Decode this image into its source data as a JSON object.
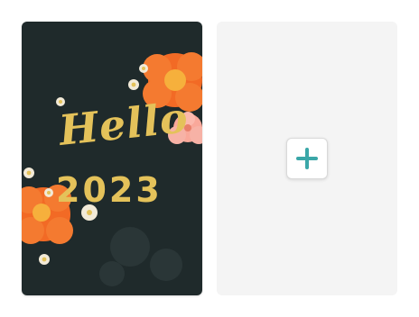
{
  "design_card": {
    "greeting": "Hello",
    "year": "2023"
  },
  "blank_card": {
    "add_icon": "plus-icon"
  },
  "colors": {
    "card_background": "#1f2a2b",
    "lettering": "#e4c25a",
    "flower_orange": "#f26a25",
    "flower_pink": "#f9a89a",
    "accent_teal": "#3aa7a8",
    "blank_card_background": "#f4f4f4"
  }
}
